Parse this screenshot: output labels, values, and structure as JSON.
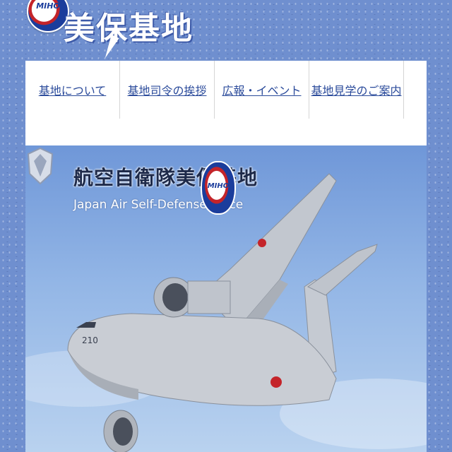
{
  "header": {
    "logo_text": "MIHO",
    "site_title": "美保基地"
  },
  "nav": {
    "items": [
      {
        "label": "基地について"
      },
      {
        "label": "基地司令の挨拶"
      },
      {
        "label": "広報・イベント"
      },
      {
        "label": "基地見学のご案内"
      }
    ]
  },
  "hero": {
    "title": "航空自衛隊美保基地",
    "subtitle": "Japan Air Self-Defense Force",
    "logo_text": "MIHO",
    "aircraft_number": "210"
  },
  "colors": {
    "background": "#6f8fcf",
    "nav_link": "#2b4b9b",
    "emblem_red": "#c4242a",
    "emblem_blue": "#1b3d9c"
  }
}
